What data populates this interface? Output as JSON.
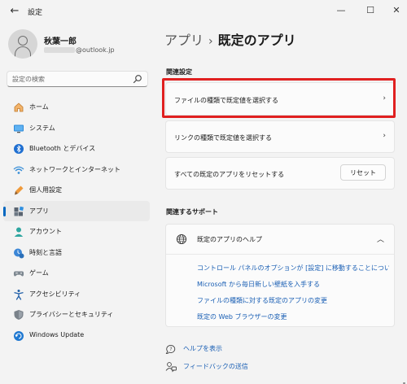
{
  "window": {
    "title": "設定",
    "back_glyph": "←",
    "minimize_glyph": "—",
    "maximize_glyph": "☐",
    "close_glyph": "✕"
  },
  "profile": {
    "name": "秋葉一郎",
    "email_domain": "@outlook.jp"
  },
  "search": {
    "placeholder": "設定の検索"
  },
  "sidebar": {
    "items": [
      {
        "label": "ホーム",
        "icon": "home-icon"
      },
      {
        "label": "システム",
        "icon": "system-icon"
      },
      {
        "label": "Bluetooth とデバイス",
        "icon": "bluetooth-icon"
      },
      {
        "label": "ネットワークとインターネット",
        "icon": "network-icon"
      },
      {
        "label": "個人用設定",
        "icon": "personalization-icon"
      },
      {
        "label": "アプリ",
        "icon": "apps-icon",
        "active": true
      },
      {
        "label": "アカウント",
        "icon": "account-icon"
      },
      {
        "label": "時刻と言語",
        "icon": "time-language-icon"
      },
      {
        "label": "ゲーム",
        "icon": "gaming-icon"
      },
      {
        "label": "アクセシビリティ",
        "icon": "accessibility-icon"
      },
      {
        "label": "プライバシーとセキュリティ",
        "icon": "privacy-icon"
      },
      {
        "label": "Windows Update",
        "icon": "windows-update-icon"
      }
    ]
  },
  "breadcrumb": {
    "parent": "アプリ",
    "separator": "›",
    "current": "既定のアプリ"
  },
  "related_settings": {
    "heading": "関連設定",
    "file_type": "ファイルの種類で既定値を選択する",
    "link_type": "リンクの種類で既定値を選択する",
    "reset_all": "すべての既定のアプリをリセットする",
    "reset_button": "リセット"
  },
  "related_support": {
    "heading": "関連するサポート",
    "help_title": "既定のアプリのヘルプ",
    "links": [
      "コントロール パネルのオプションが [設定] に移動することについて",
      "Microsoft から毎日新しい壁紙を入手する",
      "ファイルの種類に対する既定のアプリの変更",
      "既定の Web ブラウザーの変更"
    ]
  },
  "footer": {
    "get_help": "ヘルプを表示",
    "feedback": "フィードバックの送信"
  },
  "colors": {
    "accent": "#0067c0",
    "highlight_box": "#e02020",
    "link": "#1a5fb4"
  }
}
